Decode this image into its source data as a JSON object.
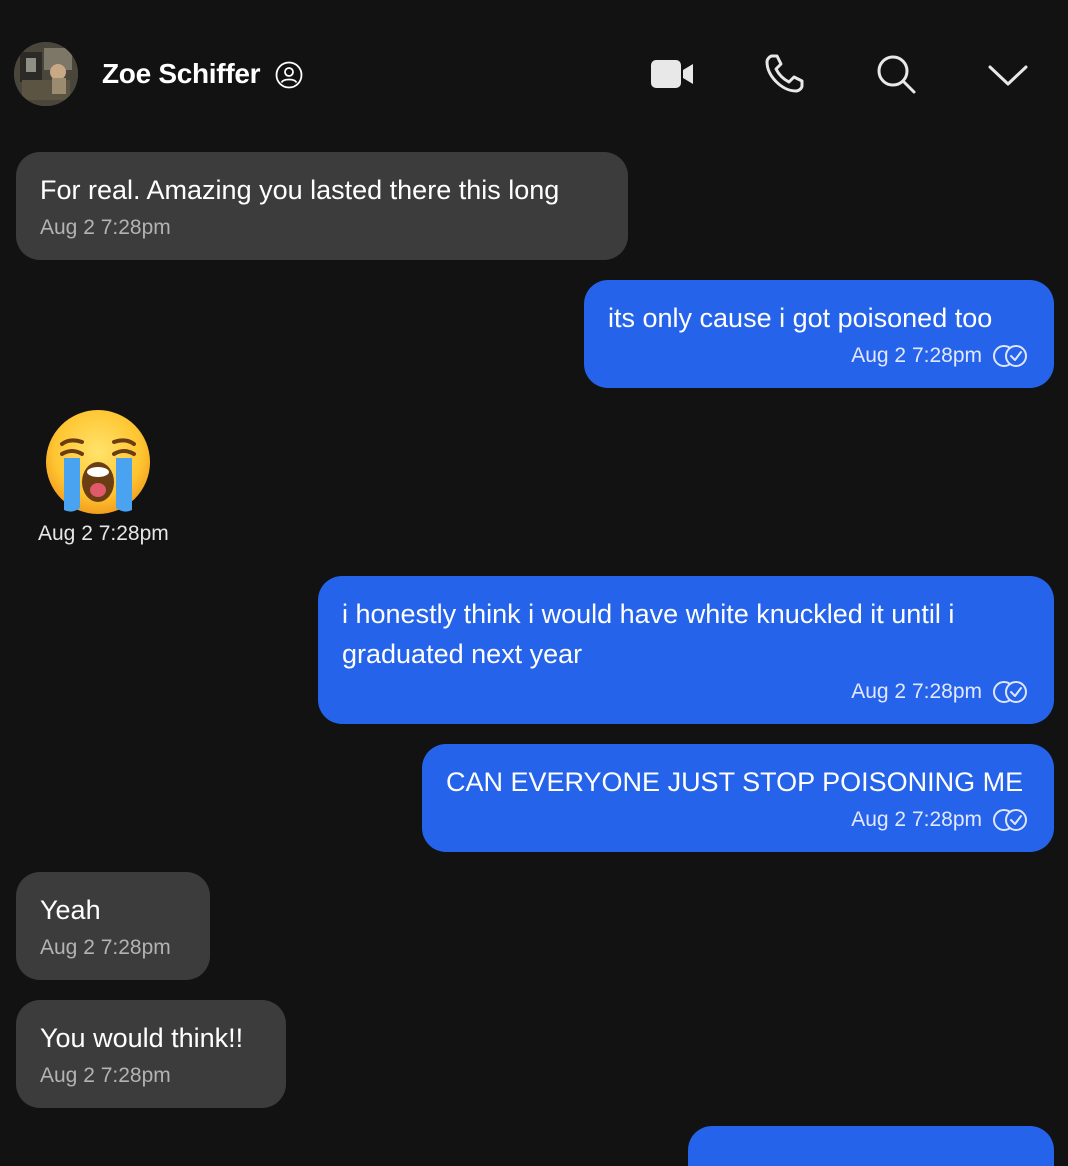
{
  "header": {
    "contact_name": "Zoe Schiffer",
    "icons": {
      "profile": "profile-icon",
      "video": "video-camera-icon",
      "call": "phone-icon",
      "search": "search-icon",
      "menu": "chevron-down-icon"
    }
  },
  "messages": [
    {
      "direction": "incoming",
      "text": "For real. Amazing you lasted there this long",
      "time": "Aug 2 7:28pm"
    },
    {
      "direction": "outgoing",
      "text": "its only cause i got poisoned too",
      "time": "Aug 2 7:28pm",
      "status_icon": "read-receipt-icon"
    },
    {
      "direction": "incoming",
      "emoji": "loudly-crying-face",
      "time": "Aug 2 7:28pm"
    },
    {
      "direction": "outgoing",
      "text": "i honestly think i would have white knuckled it until i graduated next year",
      "time": "Aug 2 7:28pm",
      "status_icon": "read-receipt-icon"
    },
    {
      "direction": "outgoing",
      "text": "CAN EVERYONE JUST STOP POISONING ME",
      "time": "Aug 2 7:28pm",
      "status_icon": "read-receipt-icon"
    },
    {
      "direction": "incoming",
      "text": "Yeah",
      "time": "Aug 2 7:28pm"
    },
    {
      "direction": "incoming",
      "text": "You would think!!",
      "time": "Aug 2 7:28pm"
    }
  ],
  "colors": {
    "background": "#121212",
    "incoming_bubble": "#3c3c3c",
    "outgoing_bubble": "#2563eb",
    "text": "#ffffff",
    "timestamp_incoming": "#b3b3b3"
  }
}
